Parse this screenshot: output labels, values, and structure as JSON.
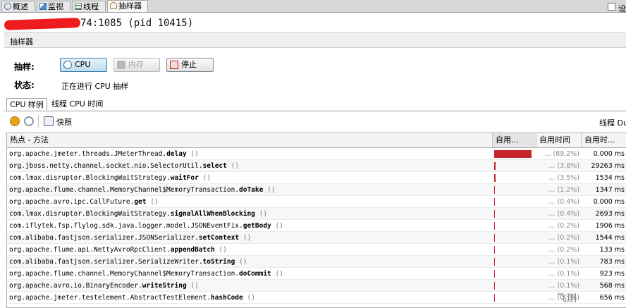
{
  "tabs": [
    {
      "label": "概述",
      "icon": "overview-icon"
    },
    {
      "label": "监视",
      "icon": "monitor-icon"
    },
    {
      "label": "线程",
      "icon": "threads-icon"
    },
    {
      "label": "抽样器",
      "icon": "sampler-icon",
      "active": true
    }
  ],
  "process_title": "74:1085 (pid 10415)",
  "sampler": {
    "header_label": "抽样器",
    "settings_label": "设",
    "sample_label": "抽样:",
    "cpu_button": "CPU",
    "memory_button": "内存",
    "stop_button": "停止",
    "status_label": "状态:",
    "status_value": "正在进行 CPU 抽样"
  },
  "subtabs": [
    "CPU 样例",
    "线程 CPU 时间"
  ],
  "toolbar": {
    "snapshot_label": "快照",
    "threads_label": "线程 Du"
  },
  "table": {
    "columns": [
      "热点 - 方法",
      "自用...",
      "自用时间",
      "自用时..."
    ],
    "rows": [
      {
        "pkg": "org.apache.jmeter.threads.JMeterThread.",
        "method": "delay",
        "suffix": " ()",
        "bar": 0.892,
        "pct": "(89.2%)",
        "time": "0.000 ms"
      },
      {
        "pkg": "org.jboss.netty.channel.socket.nio.SelectorUtil.",
        "method": "select",
        "suffix": " ()",
        "bar": 0.038,
        "pct": "(3.8%)",
        "time": "29263 ms"
      },
      {
        "pkg": "com.lmax.disruptor.BlockingWaitStrategy.",
        "method": "waitFor",
        "suffix": " ()",
        "bar": 0.035,
        "pct": "(3.5%)",
        "time": "1534 ms"
      },
      {
        "pkg": "org.apache.flume.channel.MemoryChannel$MemoryTransaction.",
        "method": "doTake",
        "suffix": " ()",
        "bar": 0.012,
        "pct": "(1.2%)",
        "time": "1347 ms"
      },
      {
        "pkg": "org.apache.avro.ipc.CallFuture.",
        "method": "get",
        "suffix": " ()",
        "bar": 0.004,
        "pct": "(0.4%)",
        "time": "0.000 ms"
      },
      {
        "pkg": "com.lmax.disruptor.BlockingWaitStrategy.",
        "method": "signalAllWhenBlocking",
        "suffix": " ()",
        "bar": 0.004,
        "pct": "(0.4%)",
        "time": "2693 ms"
      },
      {
        "pkg": "com.iflytek.fsp.flylog.sdk.java.logger.model.JSONEventFix.",
        "method": "getBody",
        "suffix": " ()",
        "bar": 0.002,
        "pct": "(0.2%)",
        "time": "1906 ms"
      },
      {
        "pkg": "com.alibaba.fastjson.serializer.JSONSerializer.",
        "method": "setContext",
        "suffix": " ()",
        "bar": 0.002,
        "pct": "(0.2%)",
        "time": "1544 ms"
      },
      {
        "pkg": "org.apache.flume.api.NettyAvroRpcClient.",
        "method": "appendBatch",
        "suffix": " ()",
        "bar": 0.002,
        "pct": "(0.2%)",
        "time": "133 ms"
      },
      {
        "pkg": "com.alibaba.fastjson.serializer.SerializeWriter.",
        "method": "toString",
        "suffix": " ()",
        "bar": 0.001,
        "pct": "(0.1%)",
        "time": "783 ms"
      },
      {
        "pkg": "org.apache.flume.channel.MemoryChannel$MemoryTransaction.",
        "method": "doCommit",
        "suffix": " ()",
        "bar": 0.001,
        "pct": "(0.1%)",
        "time": "923 ms"
      },
      {
        "pkg": "org.apache.avro.io.BinaryEncoder.",
        "method": "writeString",
        "suffix": " ()",
        "bar": 0.001,
        "pct": "(0.1%)",
        "time": "568 ms"
      },
      {
        "pkg": "org.apache.jmeter.testelement.AbstractTestElement.",
        "method": "hashCode",
        "suffix": " ()",
        "bar": 0.001,
        "pct": "(0.1%)",
        "time": "656 ms"
      }
    ]
  },
  "watermark": "飞测",
  "colors": {
    "bar": "#c4262b",
    "redaction": "#ee1c1c"
  }
}
